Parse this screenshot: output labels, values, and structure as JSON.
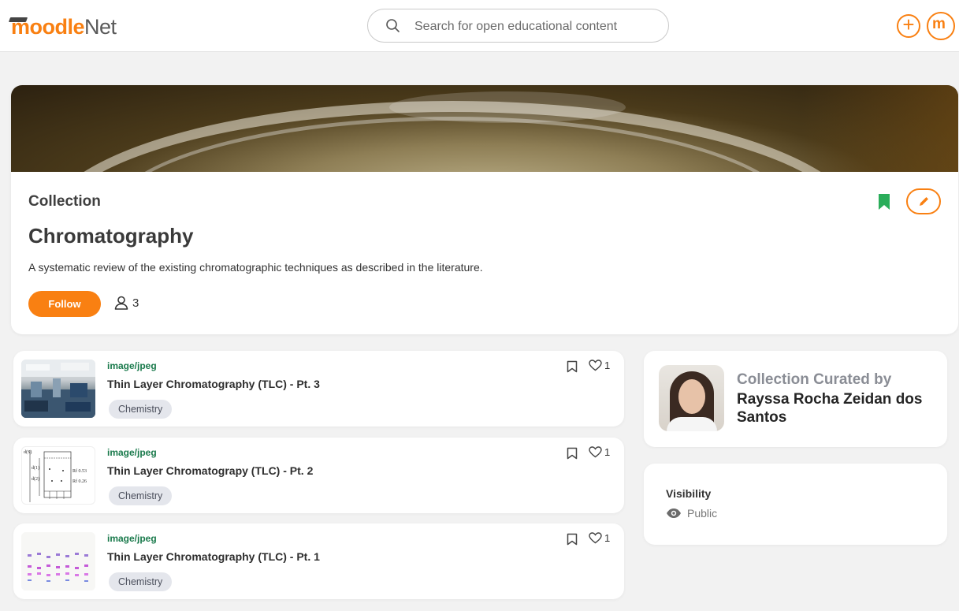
{
  "header": {
    "logo_moodle": "moodle",
    "logo_net": "Net",
    "search_placeholder": "Search for open educational content",
    "add_button_symbol": "+",
    "avatar_initial": "m"
  },
  "collection": {
    "label": "Collection",
    "title": "Chromatography",
    "description": "A systematic review of the existing chromatographic techniques as described in the literature.",
    "follow_label": "Follow",
    "follower_count": "3",
    "bookmark_color": "#2aad5a",
    "accent_color": "#f98012"
  },
  "resources": [
    {
      "type": "image/jpeg",
      "title": "Thin Layer Chromatography (TLC) - Pt. 3",
      "tag": "Chemistry",
      "likes": "1",
      "thumbnail": "lab-photo"
    },
    {
      "type": "image/jpeg",
      "title": "Thin Layer Chromatograpy (TLC) - Pt. 2",
      "tag": "Chemistry",
      "likes": "1",
      "thumbnail": "tlc-diagram",
      "thumb_text": {
        "front": "d(S)",
        "d1": "d(1)",
        "d2": "d(2)",
        "rf1": "Rf 0.53",
        "rf2": "Rf 0.26"
      }
    },
    {
      "type": "image/jpeg",
      "title": "Thin Layer Chromatography (TLC) - Pt. 1",
      "tag": "Chemistry",
      "likes": "1",
      "thumbnail": "tlc-plate"
    }
  ],
  "curator": {
    "label": "Collection Curated by",
    "name": "Rayssa Rocha Zeidan dos Santos"
  },
  "visibility": {
    "label": "Visibility",
    "value": "Public"
  }
}
